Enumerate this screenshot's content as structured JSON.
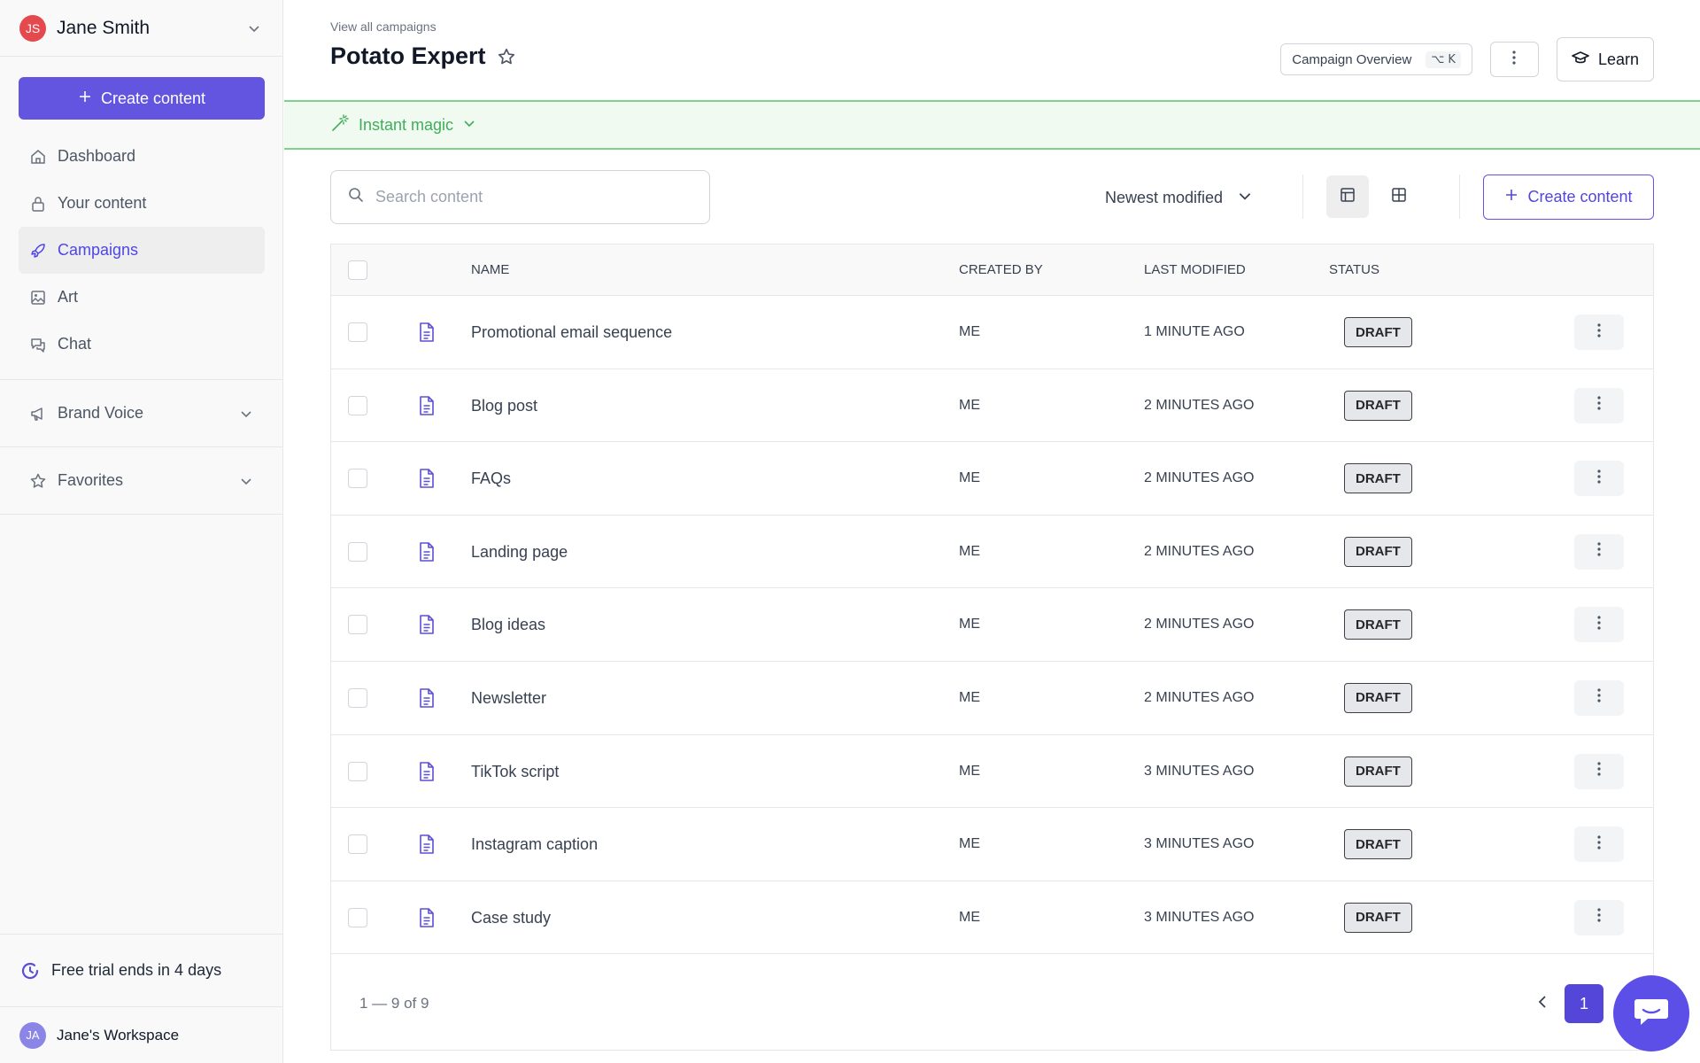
{
  "user": {
    "initials": "JS",
    "name": "Jane Smith"
  },
  "sidebar": {
    "create_label": "Create content",
    "nav": [
      {
        "label": "Dashboard",
        "icon": "home-icon"
      },
      {
        "label": "Your content",
        "icon": "lock-icon"
      },
      {
        "label": "Campaigns",
        "icon": "rocket-icon",
        "active": true
      },
      {
        "label": "Art",
        "icon": "image-icon"
      },
      {
        "label": "Chat",
        "icon": "chat-icon"
      }
    ],
    "brand_voice": "Brand Voice",
    "favorites": "Favorites",
    "trial": "Free trial ends in 4 days",
    "workspace_initials": "JA",
    "workspace": "Jane's Workspace"
  },
  "header": {
    "breadcrumb": "View all campaigns",
    "title": "Potato Expert",
    "overview_label": "Campaign Overview",
    "shortcut": "⌥ K",
    "learn_label": "Learn"
  },
  "magic": {
    "label": "Instant magic"
  },
  "toolbar": {
    "search_placeholder": "Search content",
    "sort_label": "Newest modified",
    "create_label": "Create content"
  },
  "table": {
    "columns": {
      "name": "NAME",
      "created_by": "CREATED BY",
      "last_modified": "LAST MODIFIED",
      "status": "STATUS"
    },
    "rows": [
      {
        "name": "Promotional email sequence",
        "created_by": "ME",
        "last_modified": "1 MINUTE AGO",
        "status": "DRAFT"
      },
      {
        "name": "Blog post",
        "created_by": "ME",
        "last_modified": "2 MINUTES AGO",
        "status": "DRAFT"
      },
      {
        "name": "FAQs",
        "created_by": "ME",
        "last_modified": "2 MINUTES AGO",
        "status": "DRAFT"
      },
      {
        "name": "Landing page",
        "created_by": "ME",
        "last_modified": "2 MINUTES AGO",
        "status": "DRAFT"
      },
      {
        "name": "Blog ideas",
        "created_by": "ME",
        "last_modified": "2 MINUTES AGO",
        "status": "DRAFT"
      },
      {
        "name": "Newsletter",
        "created_by": "ME",
        "last_modified": "2 MINUTES AGO",
        "status": "DRAFT"
      },
      {
        "name": "TikTok script",
        "created_by": "ME",
        "last_modified": "3 MINUTES AGO",
        "status": "DRAFT"
      },
      {
        "name": "Instagram caption",
        "created_by": "ME",
        "last_modified": "3 MINUTES AGO",
        "status": "DRAFT"
      },
      {
        "name": "Case study",
        "created_by": "ME",
        "last_modified": "3 MINUTES AGO",
        "status": "DRAFT"
      }
    ],
    "count_label": "1 — 9 of 9",
    "current_page": "1"
  },
  "colors": {
    "accent": "#6355e0",
    "magic_green": "#3fae5a",
    "avatar_red": "#e5484d"
  }
}
